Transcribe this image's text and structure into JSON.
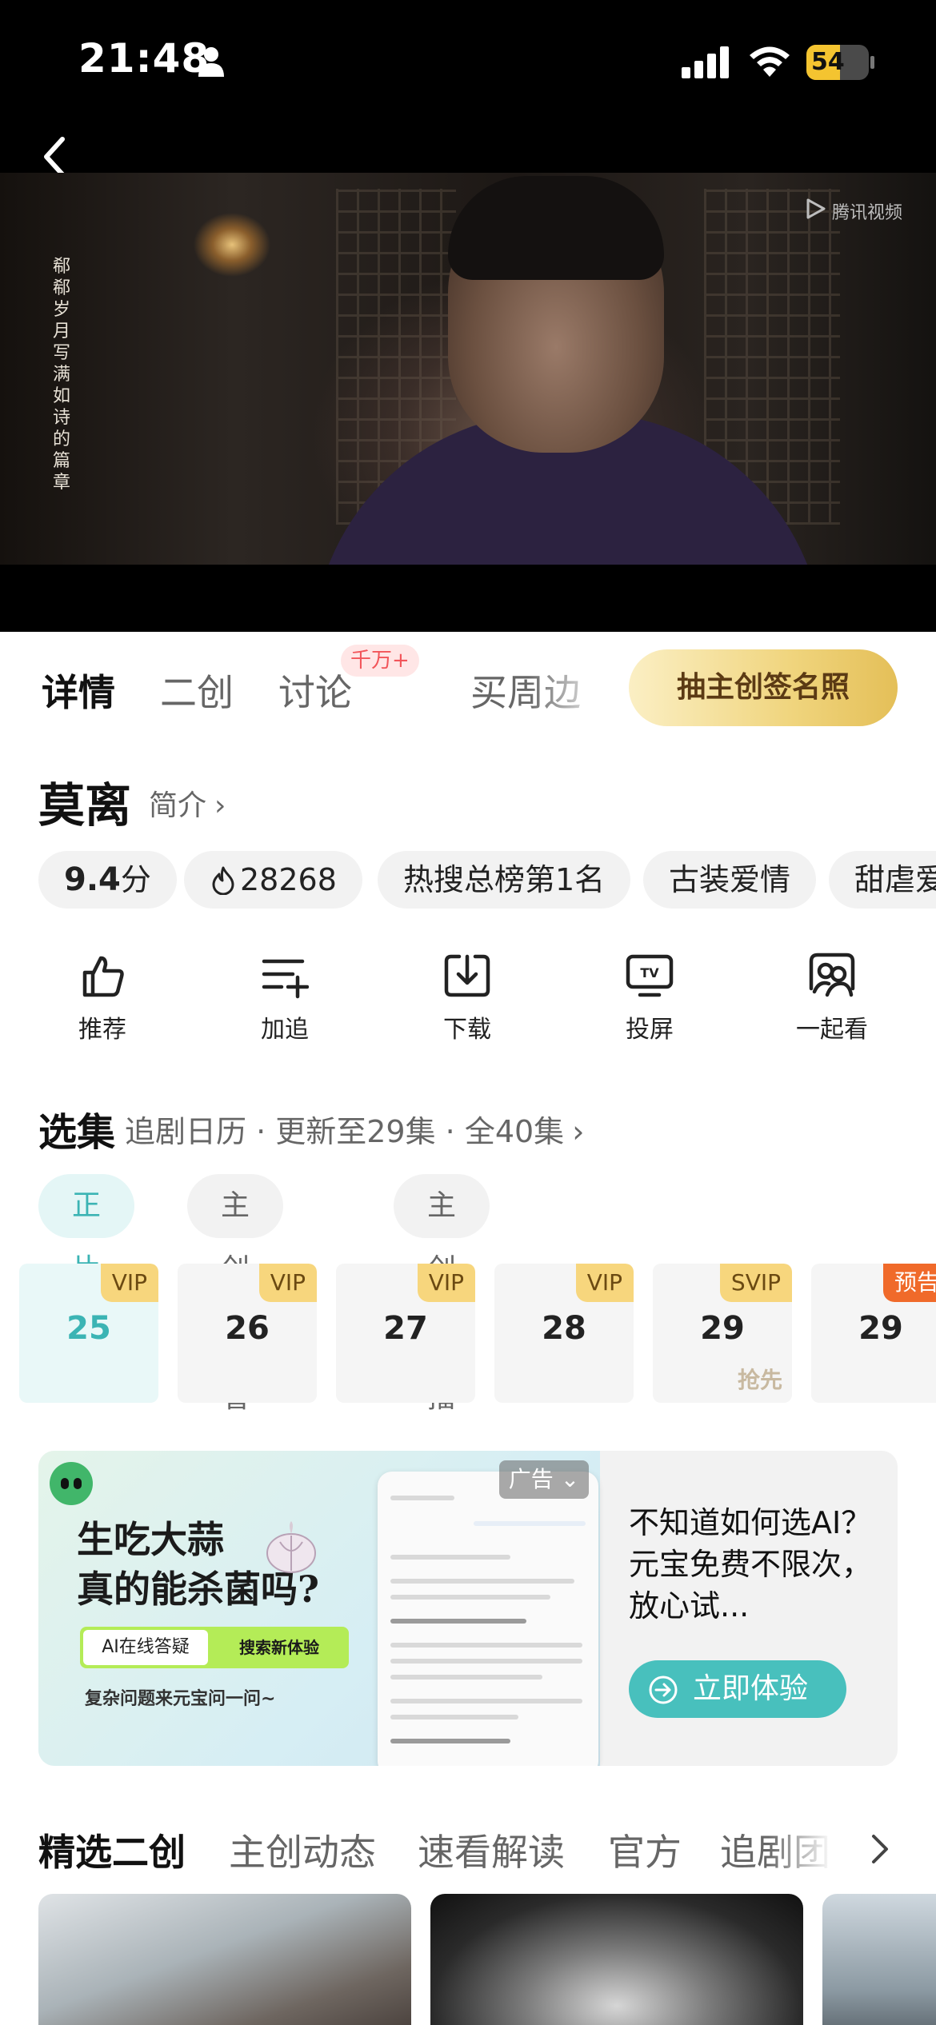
{
  "status_bar": {
    "time": "21:48",
    "battery_level": "54",
    "battery_fraction": 0.54
  },
  "video": {
    "watermark": "腾讯视频",
    "poem": "郗郗岁月写满如诗的篇章"
  },
  "tabs": {
    "items": [
      {
        "label": "详情",
        "active": true
      },
      {
        "label": "二创"
      },
      {
        "label": "讨论",
        "badge": "千万+"
      },
      {
        "label": "买周边"
      }
    ],
    "promo": "抽主创签名照"
  },
  "show": {
    "title": "莫离",
    "intro_link": "简介",
    "tags": [
      {
        "score": "9.4",
        "unit": "分"
      },
      {
        "label": "28268",
        "icon": "flame-icon"
      },
      {
        "label": "热搜总榜第1名"
      },
      {
        "label": "古装爱情"
      },
      {
        "label": "甜虐爱"
      }
    ]
  },
  "actions": [
    {
      "label": "推荐",
      "icon": "thumbs-up-icon"
    },
    {
      "label": "加追",
      "icon": "add-list-icon"
    },
    {
      "label": "下载",
      "icon": "download-icon"
    },
    {
      "label": "投屏",
      "icon": "tv-cast-icon"
    },
    {
      "label": "一起看",
      "icon": "watch-together-icon"
    }
  ],
  "episodes": {
    "title": "选集",
    "subtitle": "追剧日历 · 更新至29集 · 全40集",
    "chips": [
      "正片",
      "主创陪看",
      "主创直播"
    ],
    "items": [
      {
        "num": "25",
        "badge": "VIP",
        "active": true
      },
      {
        "num": "26",
        "badge": "VIP"
      },
      {
        "num": "27",
        "badge": "VIP"
      },
      {
        "num": "28",
        "badge": "VIP"
      },
      {
        "num": "29",
        "badge": "SVIP",
        "note": "抢先"
      },
      {
        "num": "29",
        "badge": "预告"
      }
    ]
  },
  "ad": {
    "label": "广告",
    "headline": "生吃大蒜\n真的能杀菌吗?",
    "input_text": "AI在线答疑",
    "input_button": "搜索新体验",
    "slogan": "复杂问题来元宝问一问~",
    "description": "不知道如何选AI？元宝免费不限次，放心试...",
    "cta": "立即体验",
    "colors": {
      "cta": "#48c0bd",
      "accent": "#b4ec57"
    }
  },
  "sub_tabs": [
    "精选二创",
    "主创动态",
    "速看解读",
    "官方",
    "追剧团"
  ],
  "colors": {
    "accent": "#3bb4b4",
    "vip_badge": "#f7d67d",
    "preview_badge": "#f06a2a",
    "promo_gold": "#f0d57e"
  }
}
